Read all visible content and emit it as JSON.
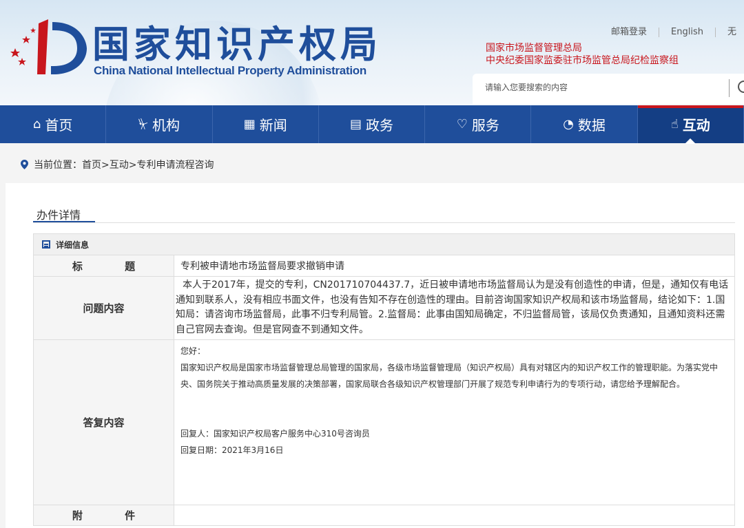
{
  "header": {
    "title_cn": "国家知识产权局",
    "title_en": "China National Intellectual Property Administration",
    "top_links": [
      "邮箱登录",
      "English",
      "无"
    ],
    "red_links": [
      "国家市场监督管理总局",
      "中央纪委国家监委驻市场监管总局纪检监察组"
    ],
    "search_placeholder": "请输入您要搜索的内容"
  },
  "nav": [
    {
      "label": "首页",
      "icon": "home-icon",
      "glyph": "⌂"
    },
    {
      "label": "机构",
      "icon": "institution-icon",
      "glyph": "⏧"
    },
    {
      "label": "新闻",
      "icon": "news-icon",
      "glyph": "▦"
    },
    {
      "label": "政务",
      "icon": "document-icon",
      "glyph": "▤"
    },
    {
      "label": "服务",
      "icon": "service-icon",
      "glyph": "♡"
    },
    {
      "label": "数据",
      "icon": "chart-icon",
      "glyph": "◔"
    },
    {
      "label": "互动",
      "icon": "hand-icon",
      "glyph": "☝",
      "active": true
    }
  ],
  "colors": {
    "brand_blue": "#1f4e9b",
    "brand_red": "#c8161d"
  },
  "breadcrumb": "当前位置：首页>互动>专利申请流程咨询",
  "tab_title": "办件详情",
  "detail": {
    "header": "详细信息",
    "title_label": "标  题",
    "title_value": "专利被申请地市场监督局要求撤销申请",
    "question_label": "问题内容",
    "question_value": "本人于2017年，提交的专利，CN201710704437.7，近日被申请地市场监督局认为是没有创造性的申请，但是，通知仅有电话通知到联系人，没有相应书面文件，也没有告知不存在创造性的理由。目前咨询国家知识产权局和该市场监督局，结论如下：1.国知局：请咨询市场监督局，此事不归专利局管。2.监督局：此事由国知局确定，不归监督局管，该局仅负责通知，且通知资料还需自己官网去查询。但是官网查不到通知文件。",
    "answer_label": "答复内容",
    "answer_greeting": "您好：",
    "answer_body": "国家知识产权局是国家市场监督管理总局管理的国家局，各级市场监督管理局（知识产权局）具有对辖区内的知识产权工作的管理职能。为落实党中央、国务院关于推动高质量发展的决策部署，国家局联合各级知识产权管理部门开展了规范专利申请行为的专项行动，请您给予理解配合。",
    "answer_replier": "回复人：国家知识产权局客户服务中心310号咨询员",
    "answer_date": "回复日期：2021年3月16日",
    "attachment_label": "附  件",
    "attachment_value": ""
  }
}
